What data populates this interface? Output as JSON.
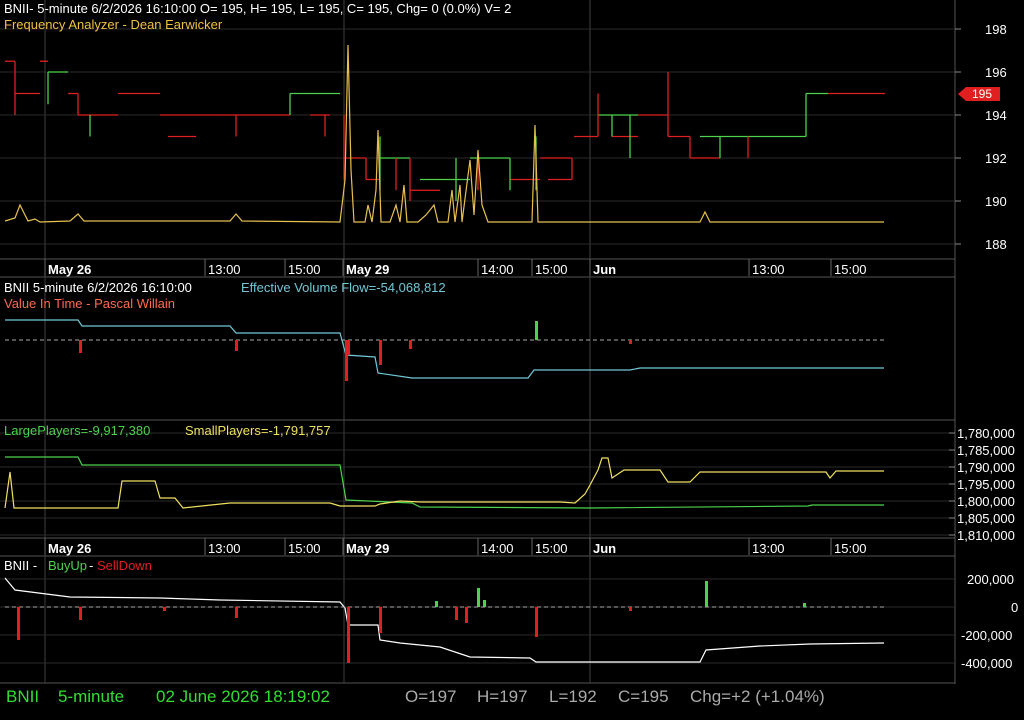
{
  "colors": {
    "up": "#4dd24d",
    "down": "#e02020",
    "yellow": "#f0e060",
    "cyan": "#70c8d8",
    "salmon": "#ff6a50",
    "grid": "#404040",
    "axisText": "#ffffff",
    "status_green": "#33dd33",
    "status_gray": "#aaaaaa"
  },
  "panel1": {
    "header": "BNII- 5-minute 6/2/2026 16:10:00 O= 195, H= 195, L= 195, C= 195, Chg= 0 (0.0%) V= 2",
    "subtitle": "Frequency Analyzer - Dean Earwicker",
    "price_tag": "195",
    "y_ticks": [
      "198",
      "196",
      "194",
      "192",
      "190",
      "188"
    ]
  },
  "time_axis": {
    "labels": [
      "May 26",
      "13:00",
      "15:00",
      "May 29",
      "14:00",
      "15:00",
      "Jun",
      "13:00",
      "15:00"
    ],
    "bold": [
      true,
      false,
      false,
      true,
      false,
      false,
      true,
      false,
      false
    ]
  },
  "panel2": {
    "header": "BNII 5-minute  6/2/2026 16:10:00",
    "evf": "Effective Volume Flow=-54,068,812",
    "subtitle": "Value In Time - Pascal Willain"
  },
  "panel3": {
    "large": "LargePlayers=-9,917,380",
    "small": "SmallPlayers=-1,791,757",
    "y_ticks": [
      "1,780,000",
      "1,785,000",
      "1,790,000",
      "1,795,000",
      "1,800,000",
      "1,805,000",
      "1,810,000"
    ]
  },
  "panel4": {
    "symbol": "BNII - ",
    "buy": "BuyUp",
    "sep": "-",
    "sell": "SellDown",
    "y_ticks": [
      "200,000",
      "0",
      "-200,000",
      "-400,000"
    ]
  },
  "status": {
    "symbol": "BNII",
    "interval": "5-minute",
    "datetime": "02 June 2026 18:19:02",
    "open": "O=197",
    "high": "H=197",
    "low": "L=192",
    "close": "C=195",
    "change": "Chg=+2 (+1.04%)"
  }
}
